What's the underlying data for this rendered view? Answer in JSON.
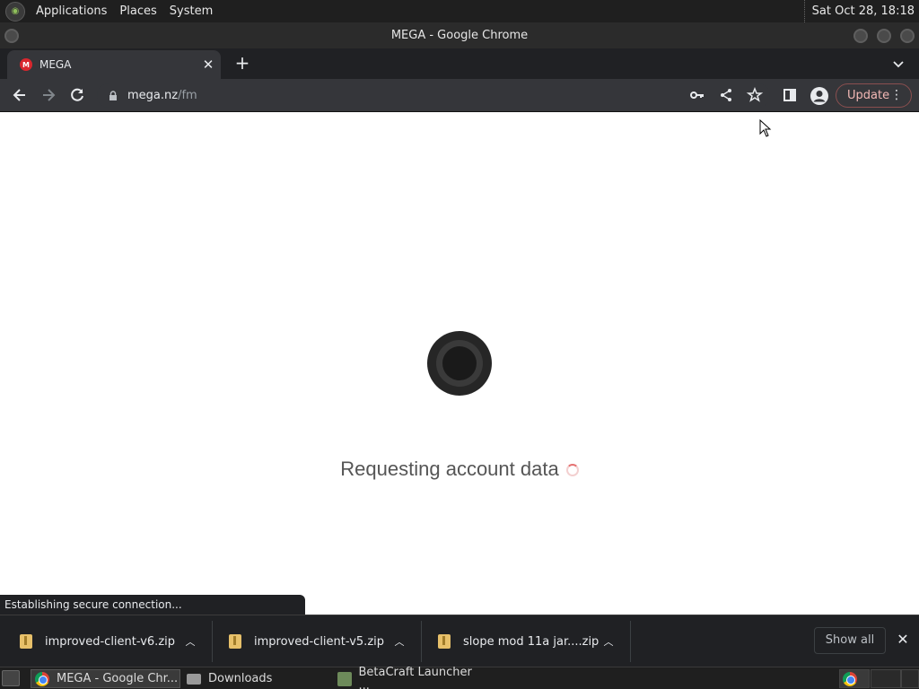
{
  "top_panel": {
    "menus": [
      "Applications",
      "Places",
      "System"
    ],
    "clock": "Sat Oct 28, 18:18"
  },
  "window": {
    "title": "MEGA - Google Chrome"
  },
  "tabs": [
    {
      "label": "MEGA",
      "favicon": "M"
    }
  ],
  "toolbar": {
    "url_host": "mega.nz",
    "url_path": "/fm",
    "update_label": "Update"
  },
  "page": {
    "loading_text": "Requesting account data"
  },
  "status_bubble": "Establishing secure connection...",
  "downloads": {
    "items": [
      {
        "filename": "improved-client-v6.zip"
      },
      {
        "filename": "improved-client-v5.zip"
      },
      {
        "filename": "slope mod 11a jar....zip"
      }
    ],
    "show_all_label": "Show all"
  },
  "taskbar": {
    "tasks": [
      {
        "label": "MEGA - Google Chr...",
        "icon": "chrome-icon",
        "active": true
      },
      {
        "label": "Downloads",
        "icon": "folder-icon",
        "active": false
      },
      {
        "label": "BetaCraft Launcher ...",
        "icon": "betacraft-icon",
        "active": false
      }
    ]
  },
  "colors": {
    "chrome_dark": "#202124",
    "toolbar": "#35363a",
    "update_accent": "#f2b8b5",
    "mega_red": "#d9272e"
  }
}
